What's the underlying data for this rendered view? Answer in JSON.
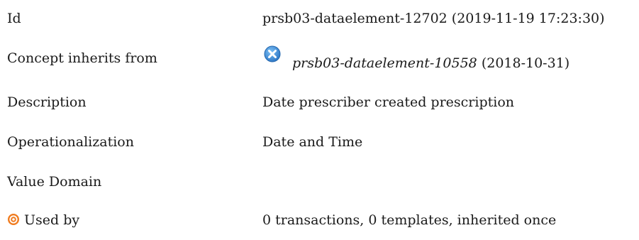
{
  "rows": {
    "id": {
      "label": "Id",
      "value": "prsb03-dataelement-12702 (2019-11-19 17:23:30)"
    },
    "inherits": {
      "label": "Concept inherits from",
      "ref_id": "prsb03-dataelement-10558",
      "ref_date": " (2018-10-31)",
      "icon": "close-circle-icon"
    },
    "description": {
      "label": "Description",
      "value": "Date prescriber created prescription"
    },
    "operationalization": {
      "label": "Operationalization",
      "value": "Date and Time"
    },
    "value_domain": {
      "label": "Value Domain",
      "value": ""
    },
    "used_by": {
      "label": "Used by",
      "icon": "target-icon",
      "value": "0 transactions, 0 templates, inherited once"
    }
  },
  "colors": {
    "badge_blue": "#3b8fd8",
    "target_orange": "#f07b1e"
  }
}
